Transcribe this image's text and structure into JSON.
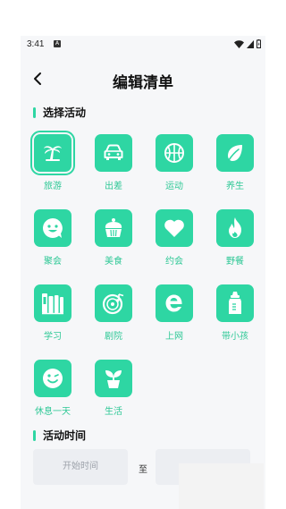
{
  "status": {
    "time": "3:41"
  },
  "header": {
    "title": "编辑清单"
  },
  "sections": {
    "activity": "选择活动",
    "time": "活动时间"
  },
  "activities": [
    {
      "label": "旅游",
      "icon": "palm-tree-icon",
      "selected": true
    },
    {
      "label": "出差",
      "icon": "car-icon",
      "selected": false
    },
    {
      "label": "运动",
      "icon": "basketball-icon",
      "selected": false
    },
    {
      "label": "养生",
      "icon": "leaf-icon",
      "selected": false
    },
    {
      "label": "聚会",
      "icon": "smile-icon",
      "selected": false
    },
    {
      "label": "美食",
      "icon": "cupcake-icon",
      "selected": false
    },
    {
      "label": "约会",
      "icon": "heart-icon",
      "selected": false
    },
    {
      "label": "野餐",
      "icon": "flame-icon",
      "selected": false
    },
    {
      "label": "学习",
      "icon": "books-icon",
      "selected": false
    },
    {
      "label": "剧院",
      "icon": "vinyl-icon",
      "selected": false
    },
    {
      "label": "上网",
      "icon": "browser-e-icon",
      "selected": false
    },
    {
      "label": "带小孩",
      "icon": "baby-bottle-icon",
      "selected": false
    },
    {
      "label": "休息一天",
      "icon": "wink-icon",
      "selected": false
    },
    {
      "label": "生活",
      "icon": "plant-pot-icon",
      "selected": false
    }
  ],
  "time": {
    "start_placeholder": "开始时间",
    "to": "至"
  },
  "colors": {
    "accent": "#2ed6a3",
    "label": "#2fc896",
    "background": "#f6f7f9"
  }
}
